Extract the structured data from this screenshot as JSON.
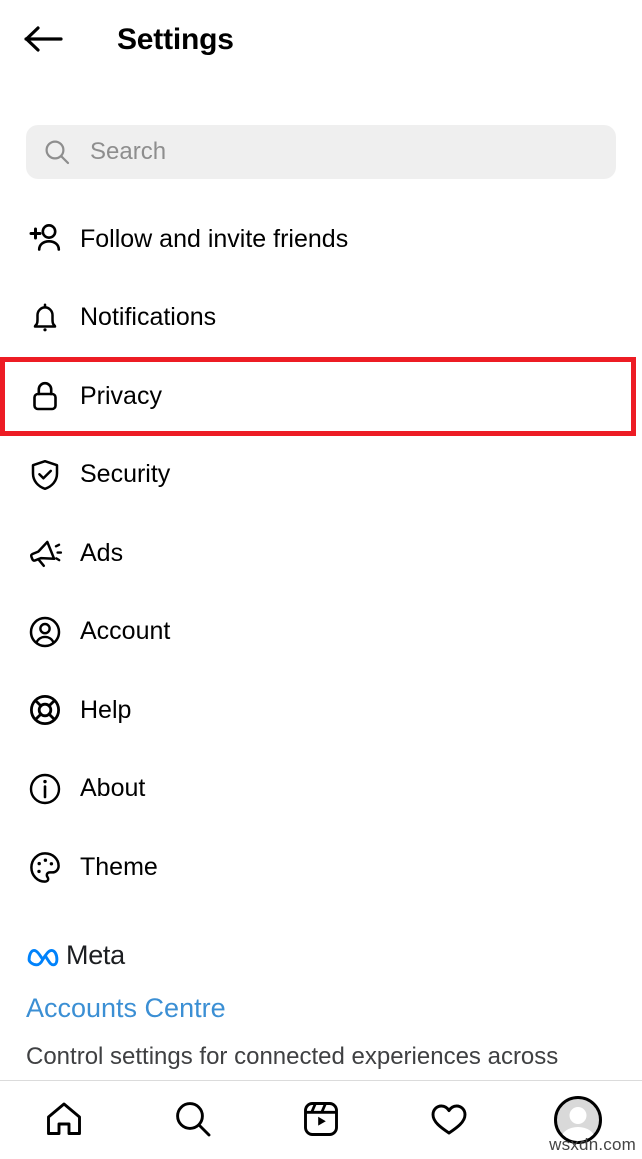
{
  "header": {
    "title": "Settings",
    "back_icon": "arrow-left-icon"
  },
  "search": {
    "placeholder": "Search",
    "value": "",
    "icon": "search-icon"
  },
  "menu": {
    "items": [
      {
        "label": "Follow and invite friends",
        "icon": "person-add-icon",
        "highlighted": false
      },
      {
        "label": "Notifications",
        "icon": "bell-icon",
        "highlighted": false
      },
      {
        "label": "Privacy",
        "icon": "lock-icon",
        "highlighted": true
      },
      {
        "label": "Security",
        "icon": "shield-check-icon",
        "highlighted": false
      },
      {
        "label": "Ads",
        "icon": "megaphone-icon",
        "highlighted": false
      },
      {
        "label": "Account",
        "icon": "user-circle-icon",
        "highlighted": false
      },
      {
        "label": "Help",
        "icon": "life-ring-icon",
        "highlighted": false
      },
      {
        "label": "About",
        "icon": "info-circle-icon",
        "highlighted": false
      },
      {
        "label": "Theme",
        "icon": "palette-icon",
        "highlighted": false
      }
    ]
  },
  "meta_section": {
    "brand": "Meta",
    "brand_icon": "meta-infinity-logo-icon",
    "accounts_centre_link": "Accounts Centre",
    "description": "Control settings for connected experiences across"
  },
  "bottom_nav": {
    "items": [
      {
        "icon": "home-icon",
        "name": "nav-home"
      },
      {
        "icon": "search-icon",
        "name": "nav-search"
      },
      {
        "icon": "reels-icon",
        "name": "nav-reels"
      },
      {
        "icon": "heart-icon",
        "name": "nav-activity"
      },
      {
        "icon": "avatar-icon",
        "name": "nav-profile"
      }
    ]
  },
  "watermark": "wsxdn.com",
  "colors": {
    "highlight": "#ed1c24",
    "link": "#3b8fd4",
    "search_bg": "#efefef",
    "meta_blue": "#0082fb",
    "divider": "#dbdbdb"
  }
}
